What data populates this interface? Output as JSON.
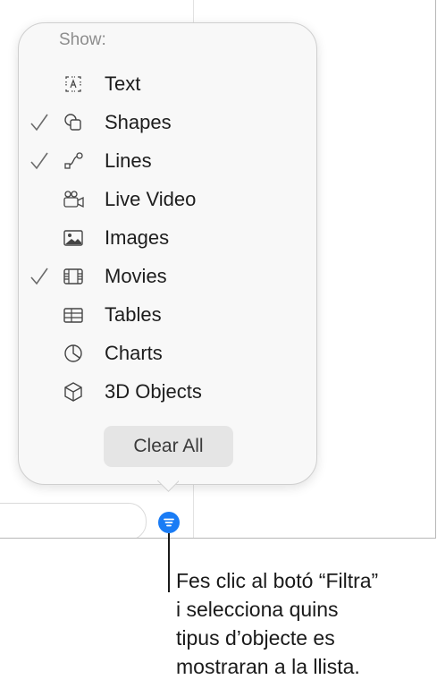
{
  "popover": {
    "title": "Show:",
    "items": [
      {
        "label": "Text",
        "checked": false,
        "icon": "text-box-icon"
      },
      {
        "label": "Shapes",
        "checked": true,
        "icon": "shapes-icon"
      },
      {
        "label": "Lines",
        "checked": true,
        "icon": "lines-icon"
      },
      {
        "label": "Live Video",
        "checked": false,
        "icon": "live-video-icon"
      },
      {
        "label": "Images",
        "checked": false,
        "icon": "image-icon"
      },
      {
        "label": "Movies",
        "checked": true,
        "icon": "movie-icon"
      },
      {
        "label": "Tables",
        "checked": false,
        "icon": "table-icon"
      },
      {
        "label": "Charts",
        "checked": false,
        "icon": "chart-icon"
      },
      {
        "label": "3D Objects",
        "checked": false,
        "icon": "cube-icon"
      }
    ],
    "clear_label": "Clear All"
  },
  "filter_button": {
    "icon": "filter-icon",
    "color": "#1a7cf5"
  },
  "callout": {
    "lines": [
      "Fes clic al botó “Filtra”",
      "i selecciona quins",
      "tipus d’objecte es",
      "mostraran a la llista."
    ]
  }
}
